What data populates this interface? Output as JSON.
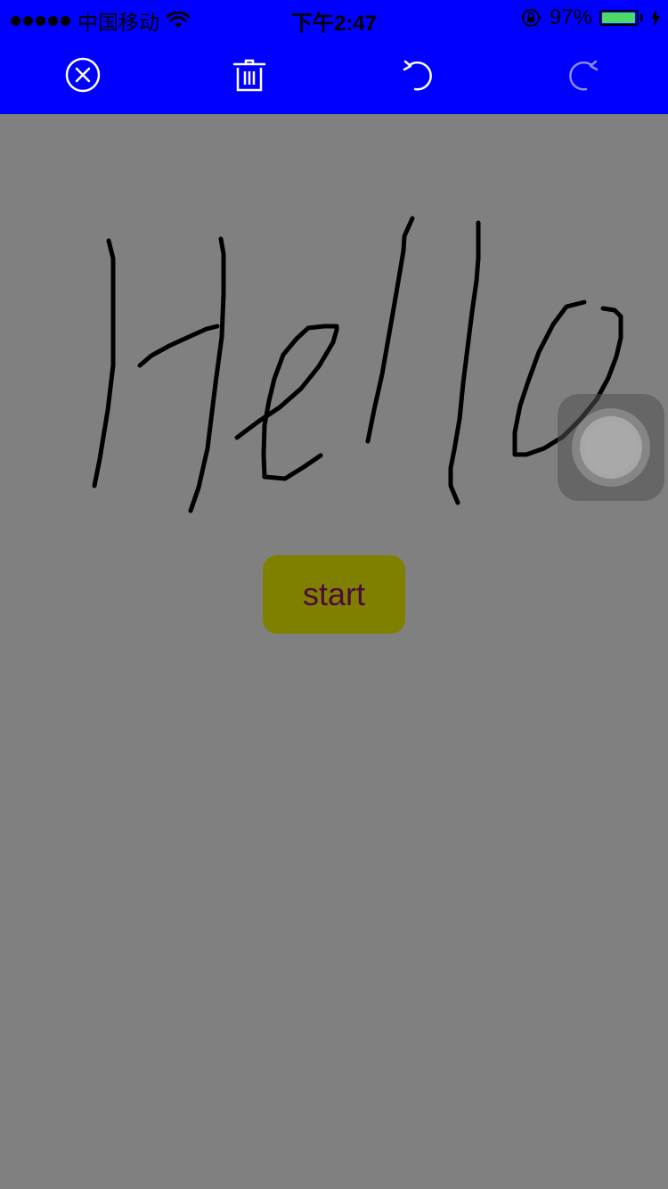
{
  "status_bar": {
    "carrier": "中国移动",
    "time": "下午2:47",
    "battery_percent": "97%",
    "battery_level": 0.97
  },
  "toolbar": {
    "buttons": [
      {
        "icon": "close-circle-icon"
      },
      {
        "icon": "trash-icon"
      },
      {
        "icon": "undo-icon",
        "enabled": true
      },
      {
        "icon": "redo-icon",
        "enabled": false
      }
    ]
  },
  "canvas": {
    "handwriting": "Hello",
    "stroke_color": "#000000",
    "background_color": "#808080"
  },
  "start_button": {
    "label": "start",
    "background": "#808000",
    "text_color": "#4b0b3a"
  },
  "colors": {
    "toolbar_bg": "#0000ff",
    "battery_fill": "#4cd964"
  }
}
